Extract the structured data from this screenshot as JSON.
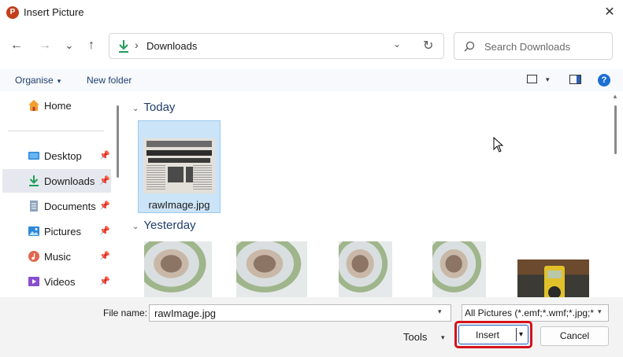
{
  "window": {
    "title": "Insert Picture",
    "app_icon_letter": "P",
    "close_glyph": "✕"
  },
  "nav": {
    "back_glyph": "←",
    "forward_glyph": "→",
    "recent_glyph": "⌄",
    "up_glyph": "↑",
    "path_separator": "›",
    "current_folder": "Downloads",
    "refresh_glyph": "↻",
    "dropdown_glyph": "⌄"
  },
  "search": {
    "placeholder": "Search Downloads",
    "value": ""
  },
  "commands": {
    "organise": "Organise",
    "new_folder": "New folder",
    "caret": "▾",
    "help": "?"
  },
  "sidebar": {
    "items": [
      {
        "label": "Home",
        "icon": "home-icon",
        "pinned": false
      },
      {
        "label": "Desktop",
        "icon": "desktop-icon",
        "pinned": true
      },
      {
        "label": "Downloads",
        "icon": "download-icon",
        "pinned": true,
        "selected": true
      },
      {
        "label": "Documents",
        "icon": "document-icon",
        "pinned": true
      },
      {
        "label": "Pictures",
        "icon": "pictures-icon",
        "pinned": true
      },
      {
        "label": "Music",
        "icon": "music-icon",
        "pinned": true
      },
      {
        "label": "Videos",
        "icon": "video-icon",
        "pinned": true
      }
    ],
    "pin_glyph": "📌"
  },
  "content": {
    "groups": [
      {
        "label": "Today",
        "caret": "⌄"
      },
      {
        "label": "Yesterday",
        "caret": "⌄"
      }
    ],
    "today_files": [
      {
        "name": "rawImage.jpg",
        "thumbnail": "newspaper-clipping",
        "selected": true
      }
    ],
    "newspaper_text": {
      "masthead": "The Houston Press",
      "headline": "SINATRA'S SON KIDNAPED",
      "subhead": "2 GUNMEN HUNTED"
    },
    "yesterday_files": [
      {
        "thumbnail": "food-photo"
      },
      {
        "thumbnail": "food-photo"
      },
      {
        "thumbnail": "food-photo"
      },
      {
        "thumbnail": "food-photo"
      },
      {
        "thumbnail": "multimeter-photo"
      }
    ]
  },
  "footer": {
    "file_name_label": "File name:",
    "file_name_value": "rawImage.jpg",
    "file_type_filter": "All Pictures (*.emf;*.wmf;*.jpg;*",
    "tools_label": "Tools",
    "insert_label": "Insert",
    "cancel_label": "Cancel",
    "caret": "▾"
  },
  "colors": {
    "accent": "#1f5fbf",
    "highlight_border": "#d4121c",
    "selection_fill": "#cce4f7",
    "powerpoint_brand": "#c43e1c",
    "download_green": "#1e9e5a"
  }
}
